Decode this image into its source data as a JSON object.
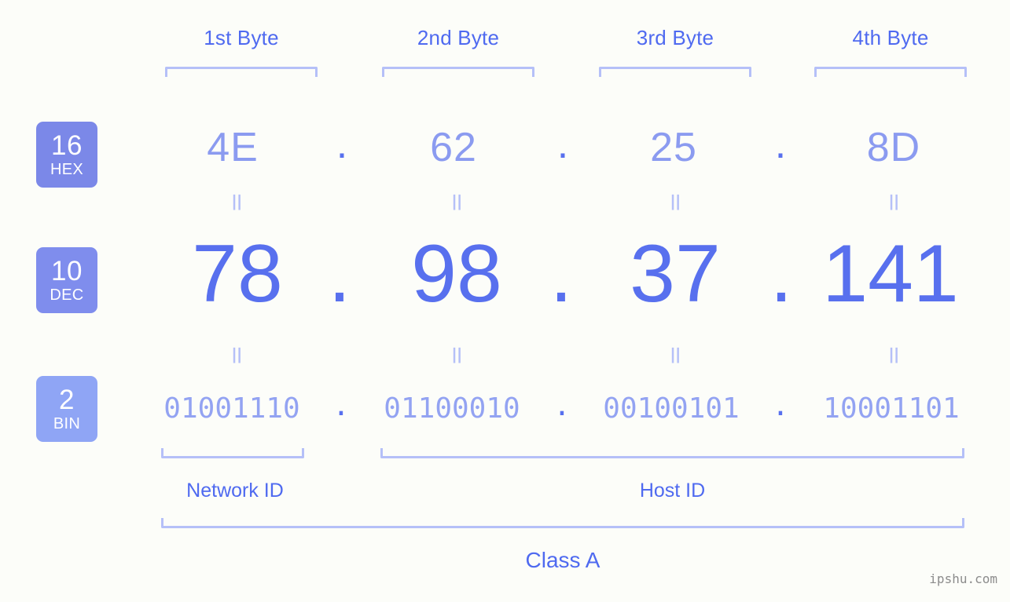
{
  "colors": {
    "background": "#fcfdf9",
    "accent_strong": "#5870ee",
    "accent_header": "#4f6af0",
    "accent_light": "#8b9bf0",
    "accent_bin": "#93a3f2",
    "bracket": "#b5c0f8",
    "badge_hex": "#7b88e8",
    "badge_dec": "#7f8ded",
    "badge_bin": "#8fa5f5",
    "watermark": "#8c8c8c"
  },
  "byte_headers": [
    {
      "label": "1st Byte"
    },
    {
      "label": "2nd Byte"
    },
    {
      "label": "3rd Byte"
    },
    {
      "label": "4th Byte"
    }
  ],
  "bases": [
    {
      "number": "16",
      "abbr": "HEX"
    },
    {
      "number": "10",
      "abbr": "DEC"
    },
    {
      "number": "2",
      "abbr": "BIN"
    }
  ],
  "rows": {
    "hex": {
      "values": [
        "4E",
        "62",
        "25",
        "8D"
      ]
    },
    "dec": {
      "values": [
        "78",
        "98",
        "37",
        "141"
      ]
    },
    "bin": {
      "values": [
        "01001110",
        "01100010",
        "00100101",
        "10001101"
      ]
    }
  },
  "separator": ".",
  "equality_symbol": "॥",
  "sections": [
    {
      "label": "Network ID"
    },
    {
      "label": "Host ID"
    }
  ],
  "class": {
    "label": "Class A"
  },
  "watermark": {
    "text": "ipshu.com"
  }
}
